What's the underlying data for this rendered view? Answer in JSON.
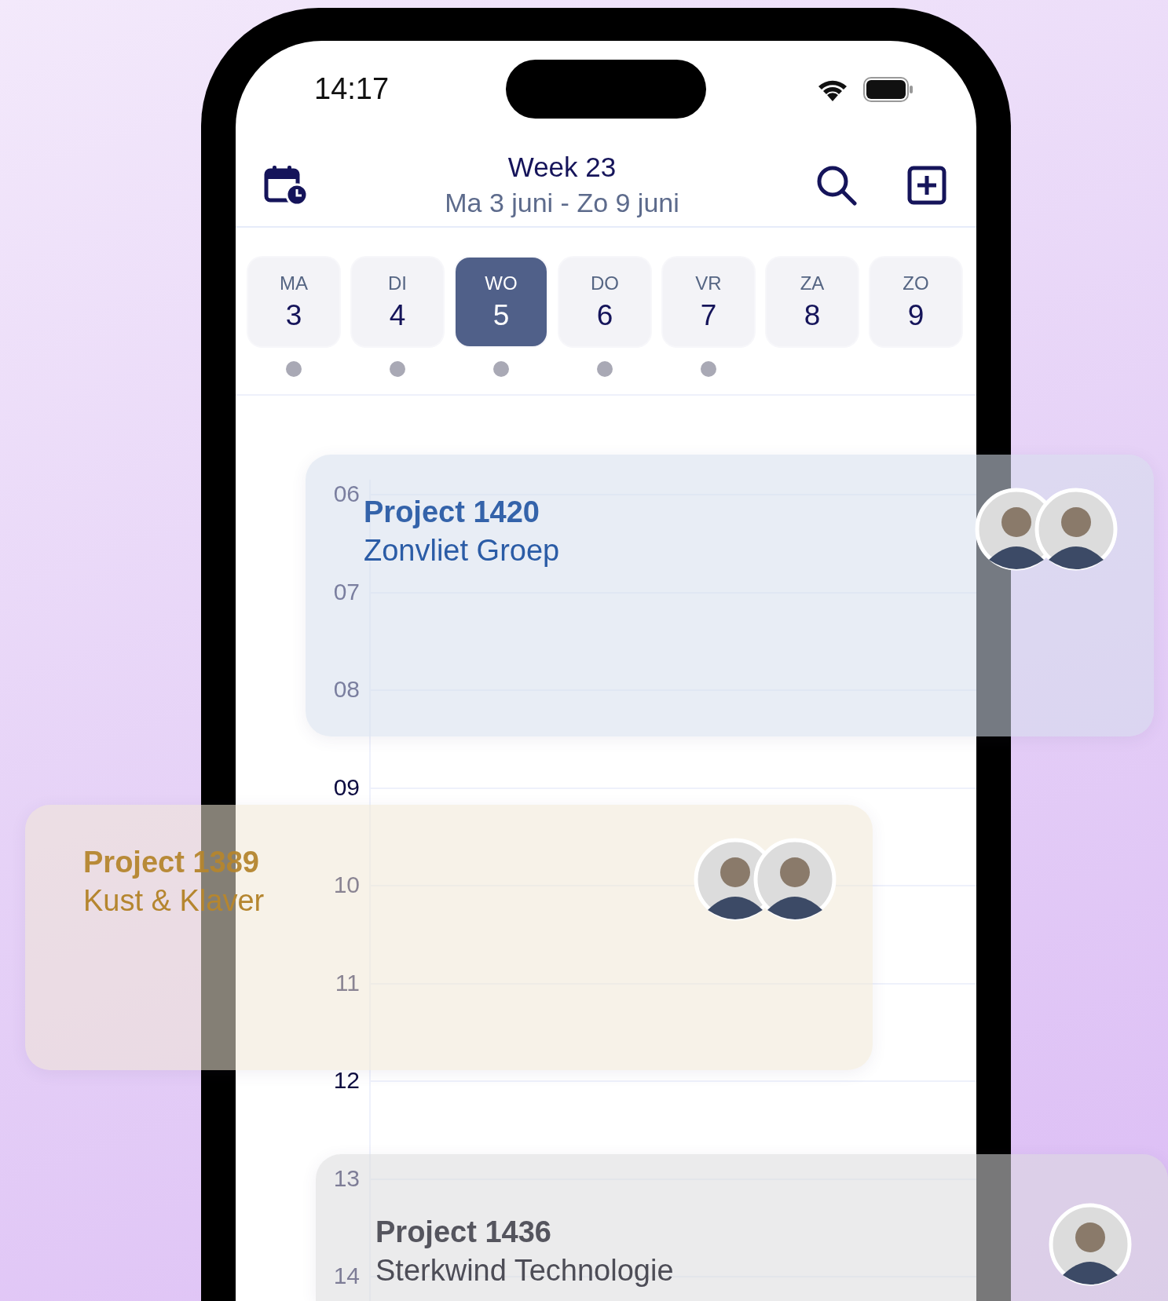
{
  "status_bar": {
    "time": "14:17"
  },
  "header": {
    "title": "Week 23",
    "subtitle": "Ma 3 juni - Zo 9 juni"
  },
  "days": [
    {
      "weekday": "MA",
      "date": "3",
      "selected": false,
      "has_events": true
    },
    {
      "weekday": "DI",
      "date": "4",
      "selected": false,
      "has_events": true
    },
    {
      "weekday": "WO",
      "date": "5",
      "selected": true,
      "has_events": true
    },
    {
      "weekday": "DO",
      "date": "6",
      "selected": false,
      "has_events": true
    },
    {
      "weekday": "VR",
      "date": "7",
      "selected": false,
      "has_events": true
    },
    {
      "weekday": "ZA",
      "date": "8",
      "selected": false,
      "has_events": false
    },
    {
      "weekday": "ZO",
      "date": "9",
      "selected": false,
      "has_events": false
    }
  ],
  "hours": [
    "06",
    "07",
    "08",
    "09",
    "10",
    "11",
    "12",
    "13",
    "14"
  ],
  "events": [
    {
      "title": "Project 1420",
      "client": "Zonvliet Groep",
      "color": "#2b5ca6"
    },
    {
      "title": "Project 1389",
      "client": "Kust & Klaver",
      "color": "#b5862f"
    },
    {
      "title": "Project 1436",
      "client": "Sterkwind Technologie",
      "color": "#4d4d57"
    }
  ]
}
